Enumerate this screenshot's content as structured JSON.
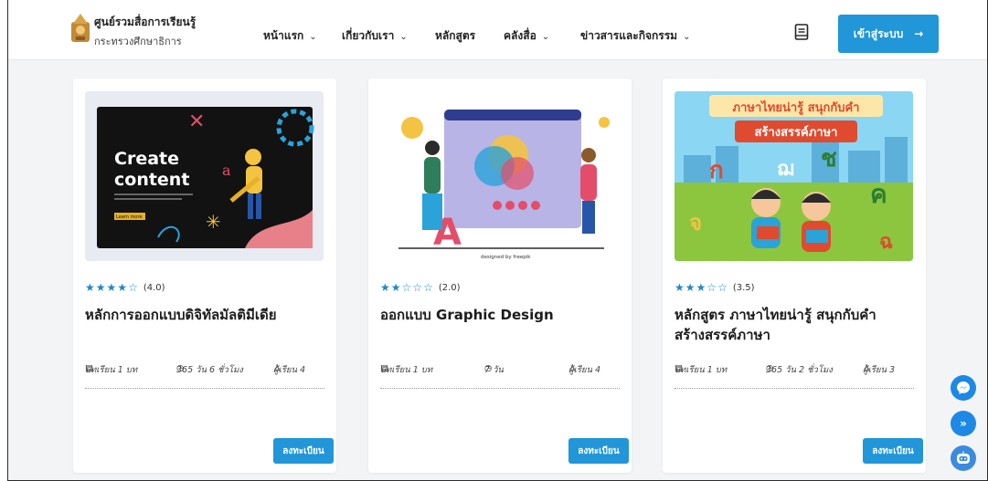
{
  "header": {
    "brand_title": "ศูนย์รวมสื่อการเรียนรู้",
    "brand_sub": "กระทรวงศึกษาธิการ",
    "nav": [
      {
        "label": "หน้าแรก",
        "has_dropdown": true
      },
      {
        "label": "เกี่ยวกับเรา",
        "has_dropdown": true
      },
      {
        "label": "หลักสูตร",
        "has_dropdown": false
      },
      {
        "label": "คลังสื่อ",
        "has_dropdown": true
      },
      {
        "label": "ข่าวสารและกิจกรรม",
        "has_dropdown": true
      }
    ],
    "chevron": "⌄",
    "login_label": "เข้าสู่ระบบ",
    "login_arrow": "→"
  },
  "courses": [
    {
      "rating_text": "(4.0)",
      "rating": 4,
      "title": "หลักการออกแบบดิจิทัลมัลติมีเดีย",
      "lessons": "บทเรียน 1 บท",
      "duration": "365 วัน 6 ชั่วโมง",
      "students": "ผู้เรียน 4",
      "enroll_label": "ลงทะเบียน",
      "thumb_text_1": "Create",
      "thumb_text_2": "content",
      "thumb_btn": "Learn more"
    },
    {
      "rating_text": "(2.0)",
      "rating": 2,
      "title": "ออกแบบ Graphic Design",
      "lessons": "บทเรียน 1 บท",
      "duration": "7 วัน",
      "students": "ผู้เรียน 4",
      "enroll_label": "ลงทะเบียน",
      "thumb_credit": "designed by freepik"
    },
    {
      "rating_text": "(3.5)",
      "rating": 3.5,
      "title": "หลักสูตร ภาษาไทยน่ารู้ สนุกกับคำ สร้างสรรค์ภาษา",
      "lessons": "บทเรียน 1 บท",
      "duration": "365 วัน 2 ชั่วโมง",
      "students": "ผู้เรียน 3",
      "enroll_label": "ลงทะเบียน",
      "thumb_banner_1": "ภาษาไทยน่ารู้ สนุกกับคำ",
      "thumb_banner_2": "สร้างสรรค์ภาษา",
      "thumb_letters": [
        "ก",
        "ฌ",
        "ช",
        "ค",
        "จ",
        "ฉ"
      ]
    }
  ],
  "colors": {
    "accent": "#2196d8",
    "star": "#1e88c8"
  },
  "icons": {
    "messenger": "messenger-icon",
    "scroll_top": "chevrons-up-icon",
    "bot": "chatbot-icon"
  }
}
